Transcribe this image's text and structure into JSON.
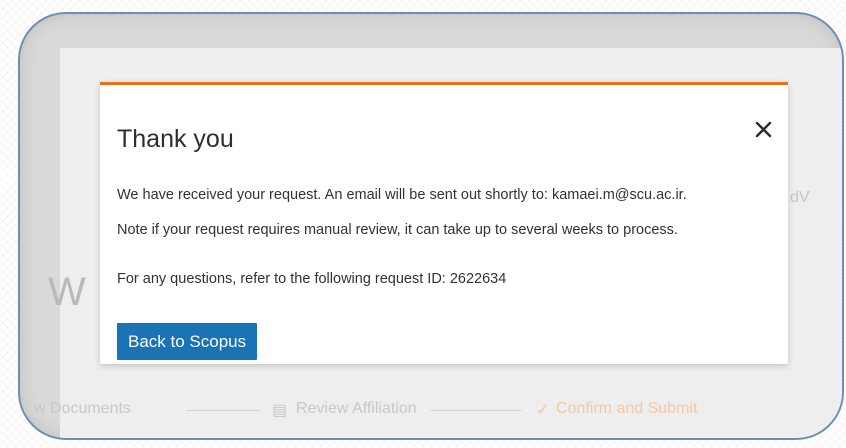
{
  "modal": {
    "title": "Thank you",
    "message_line1": "We have received your request. An email will be sent out shortly to: kamaei.m@scu.ac.ir.",
    "message_line2": "Note if your request requires manual review, it can take up to several weeks to process.",
    "request_line": "For any questions, refer to the following request ID: 2622634",
    "back_button": "Back to Scopus",
    "close_glyph": "×",
    "accent_color": "#e9711c",
    "button_color": "#1a73b4"
  },
  "background": {
    "partial_heading": "W",
    "partial_right_text": "dV",
    "steps": [
      {
        "label": "w Documents"
      },
      {
        "label": "Review Affiliation"
      },
      {
        "label": "Confirm and Submit",
        "icon": "check-icon"
      }
    ]
  }
}
